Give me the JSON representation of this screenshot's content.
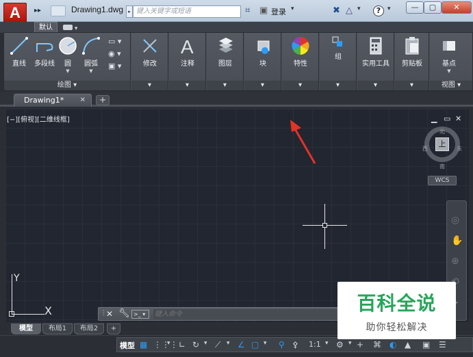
{
  "titlebar": {
    "app_logo": "A",
    "document_title": "Drawing1.dwg",
    "search_placeholder": "键入关键字或短语",
    "login": "登录",
    "help": "?",
    "window_buttons": [
      "—",
      "▢",
      "✕"
    ]
  },
  "ribbon": {
    "tabs": [
      "默认"
    ],
    "draw_tools": [
      "直线",
      "多段线",
      "圆",
      "圆弧"
    ],
    "panels": [
      {
        "name": "修改"
      },
      {
        "name": "注释"
      },
      {
        "name": "图层"
      },
      {
        "name": "块"
      },
      {
        "name": "特性"
      },
      {
        "name": "组"
      },
      {
        "name": "实用工具"
      },
      {
        "name": "剪贴板"
      },
      {
        "name": "基点"
      }
    ],
    "footers": {
      "draw": "绘图 ▾",
      "view": "视图 ▾"
    }
  },
  "file_tabs": {
    "active": "Drawing1*",
    "close": "✕",
    "new": "+"
  },
  "viewport": {
    "label": "[−][俯视][二维线框]",
    "controls": [
      "▁",
      "▭",
      "✕"
    ],
    "viewcube": {
      "top": "上",
      "north": "北",
      "south": "南",
      "west": "西",
      "east": "东"
    },
    "wcs": "WCS",
    "ucs": {
      "x": "X",
      "y": "Y"
    }
  },
  "command_line": {
    "placeholder": "键入命令"
  },
  "layout_tabs": [
    "模型",
    "布局1",
    "布局2"
  ],
  "status_bar": {
    "model": "模型",
    "scale": "1:1"
  },
  "watermark": {
    "title": "百科全说",
    "subtitle": "助你轻松解决"
  },
  "colors": {
    "canvas_bg": "#212630",
    "accent_blue": "#2d9cf4",
    "arrow_red": "#e53227",
    "watermark_green": "#27a55a"
  }
}
